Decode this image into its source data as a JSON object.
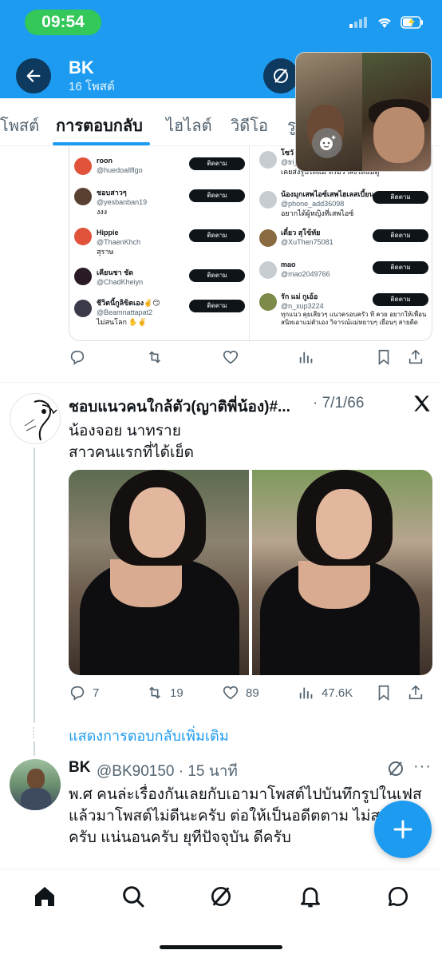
{
  "status_bar": {
    "time": "09:54"
  },
  "header": {
    "title": "BK",
    "subtitle": "16 โพสต์"
  },
  "tabs": [
    {
      "label": "โพสต์",
      "active": false
    },
    {
      "label": "การตอบกลับ",
      "active": true
    },
    {
      "label": "ไฮไลต์",
      "active": false
    },
    {
      "label": "วิดีโอ",
      "active": false
    },
    {
      "label": "รู",
      "active": false
    }
  ],
  "embedded_card": {
    "follow_label": "ติดตาม",
    "left_users": [
      {
        "name": "roon",
        "handle": "@huedoallflgo",
        "bio": ""
      },
      {
        "name": "ชอบสาวๆ",
        "handle": "@yesbanban19",
        "bio": "งงง"
      },
      {
        "name": "Hippie",
        "handle": "@ThaenKhch",
        "bio": "สุราษ"
      },
      {
        "name": "เคียนชา ชัด",
        "handle": "@ChadKheiyn",
        "bio": ""
      },
      {
        "name": "ชีวิตนี้กูลิขิตเอง✌️😏",
        "handle": "@Beamnattapat2",
        "bio": "ไม่สนโลก ✋✌️"
      }
    ],
    "right_users": [
      {
        "name": "โซวั",
        "handle": "@tri_s",
        "bio": "เคยส่งรูปให้แม่ หรือว่าส่งให้แม่ดู"
      },
      {
        "name": "น้องมุกเสพไอซ์เสพไฮเลสเบี้ยน",
        "handle": "@phone_add36098",
        "bio": "อยากได้ผู้หญิงที่เสพไอซ์"
      },
      {
        "name": "เดี๋ยว สุโข้ทัย",
        "handle": "@XuThen75081",
        "bio": ""
      },
      {
        "name": "mao",
        "handle": "@mao2049766",
        "bio": ""
      },
      {
        "name": "รัก แม่ กูเอ้อ",
        "handle": "@n_xup3224",
        "bio": "ทุกแนว คุยเสียวๆ แนวครอบครัว ที ควย อยากให้เพื่อนสนิทเอาแม่ตัวเอง วิจารณ์แม่หยาบๆ เยื่อนๆ สายดีด"
      }
    ]
  },
  "tweet_reply_parent": {
    "author_name": "ชอบแนวคนใกล้ตัว(ญาติพี่น้อง)#...",
    "date": "· 7/1/66",
    "text_lines": [
      "น้องจอย นาทราย",
      "สาวคนแรกที่ได้เย็ด"
    ],
    "replies": "7",
    "retweets": "19",
    "likes": "89",
    "views": "47.6K",
    "show_more": "แสดงการตอบกลับเพิ่มเติม"
  },
  "tweet_reply": {
    "author_name": "BK",
    "handle_time": "@BK90150 · 15 นาที",
    "more": "···",
    "text": "พ.ศ คนล่ะเรื่องกันเลยกับเอามาโพสต์ไปบันทึกรูปในเฟส แล้วมาโพสต์ไม่ดีนะครับ ต่อให้เป็นอดีตตาม ไม่สมควร ครับ แน่นอนครับ ยุทีปัจจุบัน ดีครับ"
  },
  "icons": {
    "back": "arrow-left-icon",
    "grok": "grok-icon",
    "reply": "reply-icon",
    "retweet": "retweet-icon",
    "like": "heart-icon",
    "views": "views-icon",
    "bookmark": "bookmark-icon",
    "share": "share-icon",
    "x_logo": "x-logo-icon",
    "compose": "plus-icon",
    "nav": [
      "home-icon",
      "search-icon",
      "grok-icon",
      "bell-icon",
      "messages-icon"
    ]
  },
  "colors": {
    "accent": "#1d9bf0",
    "status_pill": "#34c759"
  }
}
